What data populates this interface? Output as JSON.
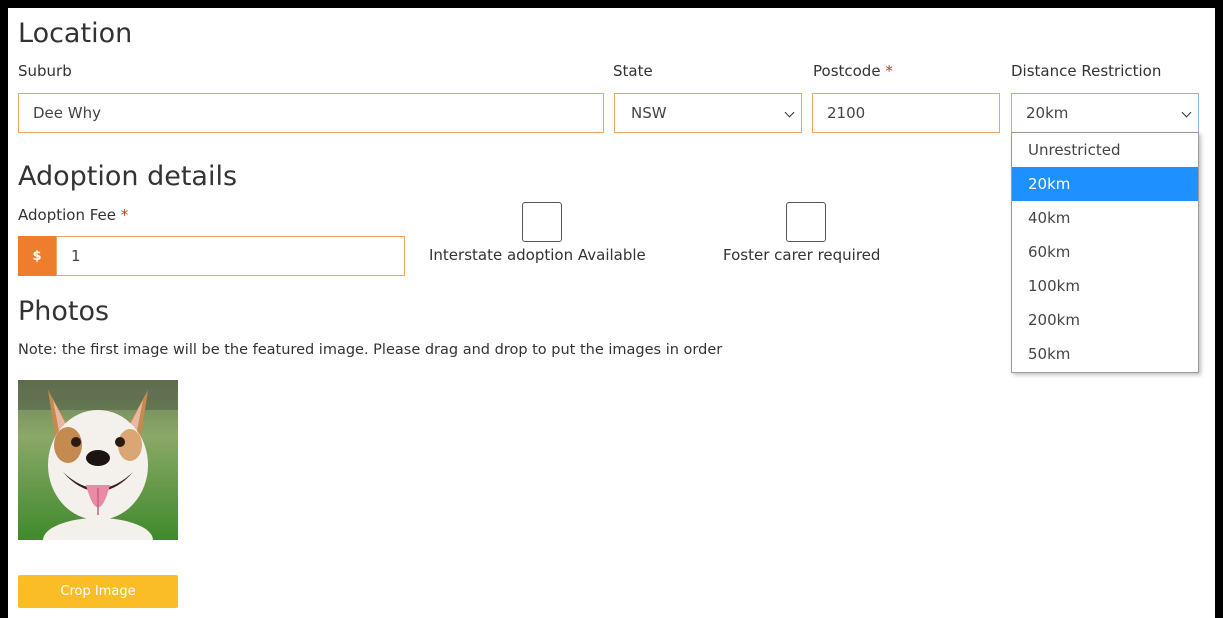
{
  "location": {
    "heading": "Location",
    "suburb": {
      "label": "Suburb",
      "value": "Dee Why"
    },
    "state": {
      "label": "State",
      "value": "NSW"
    },
    "postcode": {
      "label": "Postcode",
      "required_mark": "*",
      "value": "2100"
    },
    "distance": {
      "label": "Distance Restriction",
      "value": "20km",
      "options": [
        "Unrestricted",
        "20km",
        "40km",
        "60km",
        "100km",
        "200km",
        "50km"
      ],
      "selected_index": 1
    }
  },
  "adoption": {
    "heading": "Adoption details",
    "fee": {
      "label": "Adoption Fee",
      "required_mark": "*",
      "prefix": "$",
      "value": "1"
    },
    "interstate_label": "Interstate adoption Available",
    "foster_label": "Foster carer required"
  },
  "photos": {
    "heading": "Photos",
    "note": "Note: the first image will be the featured image. Please drag and drop to put the images in order",
    "crop_button": "Crop Image"
  },
  "colors": {
    "accent_orange": "#ef7d2e",
    "field_border": "#f0a45f",
    "crop_button": "#fbbd25",
    "dropdown_selected": "#1e90ff"
  }
}
